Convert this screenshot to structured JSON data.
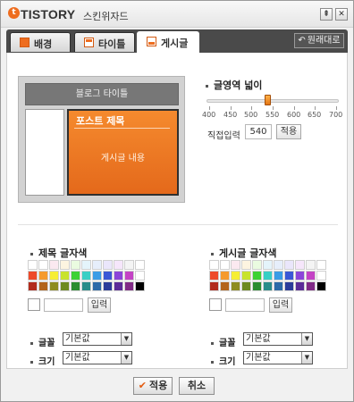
{
  "window": {
    "brand": "TISTORY",
    "title": "스킨위자드",
    "pin_icon": "pin-icon",
    "close_icon": "close-icon",
    "logo_glyph": "t"
  },
  "tabs": [
    {
      "label": "배경",
      "icon": "background-icon"
    },
    {
      "label": "타이틀",
      "icon": "title-icon"
    },
    {
      "label": "게시글",
      "icon": "post-icon",
      "active": true
    }
  ],
  "restore_label": "원래대로",
  "preview": {
    "header": "블로그 타이틀",
    "post_title": "포스트 제목",
    "post_body": "게시글 내용"
  },
  "width_section": {
    "title": "글영역 넓이",
    "ticks": [
      "400",
      "450",
      "500",
      "550",
      "600",
      "650",
      "700"
    ],
    "value": 540,
    "min": 400,
    "max": 700,
    "direct_label": "직접입력",
    "input_value": "540",
    "apply_label": "적용"
  },
  "colors": {
    "title_label": "제목 글자색",
    "post_label": "게시글 글자색",
    "input_button": "입력",
    "palette": [
      "#ffffff",
      "#ffffff",
      "#fbe9f0",
      "#fdf4e0",
      "#eafbe0",
      "#e4f4fb",
      "#e6eefb",
      "#eae6fb",
      "#f6e6fb",
      "#f4f4f4",
      "#ffffff",
      "#ee4a2b",
      "#f59a2e",
      "#f6ee34",
      "#c8e32d",
      "#3dd234",
      "#38cfc5",
      "#3a9ce6",
      "#3b58d6",
      "#8c45d9",
      "#c443c5",
      "#ffffff",
      "#b22c1d",
      "#b3641b",
      "#8e8c20",
      "#6d8a1f",
      "#2b8d30",
      "#298c8a",
      "#2c6aa8",
      "#2b3c9a",
      "#5b2c98",
      "#802a86",
      "#000000"
    ]
  },
  "font": {
    "font_label": "글꼴",
    "size_label": "크기",
    "default_value": "기본값"
  },
  "buttons": {
    "apply": "적용",
    "cancel": "취소"
  }
}
